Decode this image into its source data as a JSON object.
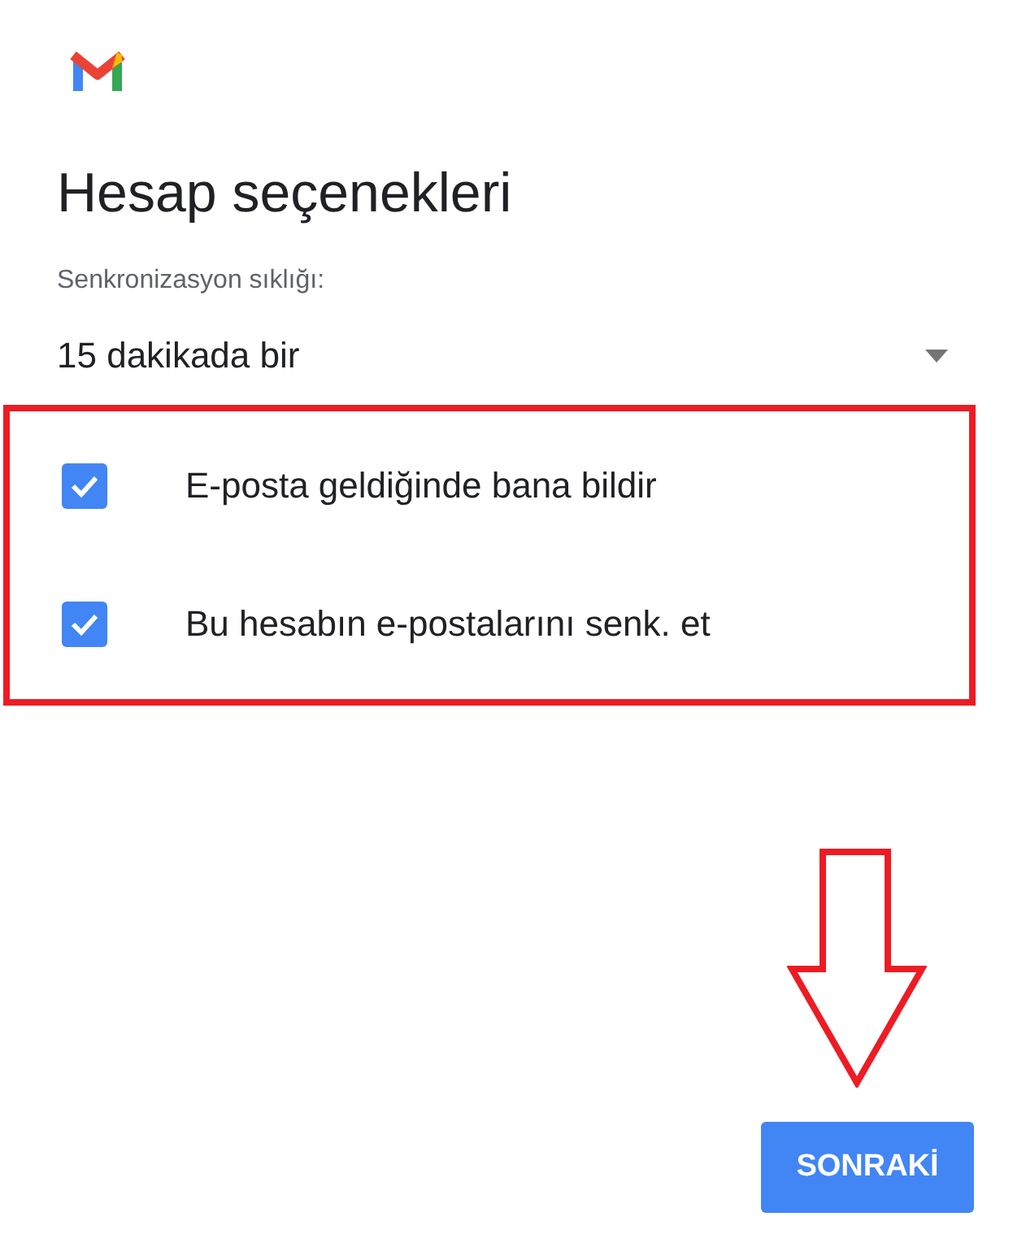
{
  "title": "Hesap seçenekleri",
  "sync": {
    "label": "Senkronizasyon sıklığı:",
    "value": "15 dakikada bir"
  },
  "options": [
    {
      "label": "E-posta geldiğinde bana bildir",
      "checked": true
    },
    {
      "label": "Bu hesabın e-postalarını senk. et",
      "checked": true
    }
  ],
  "next_button": "SONRAKİ"
}
